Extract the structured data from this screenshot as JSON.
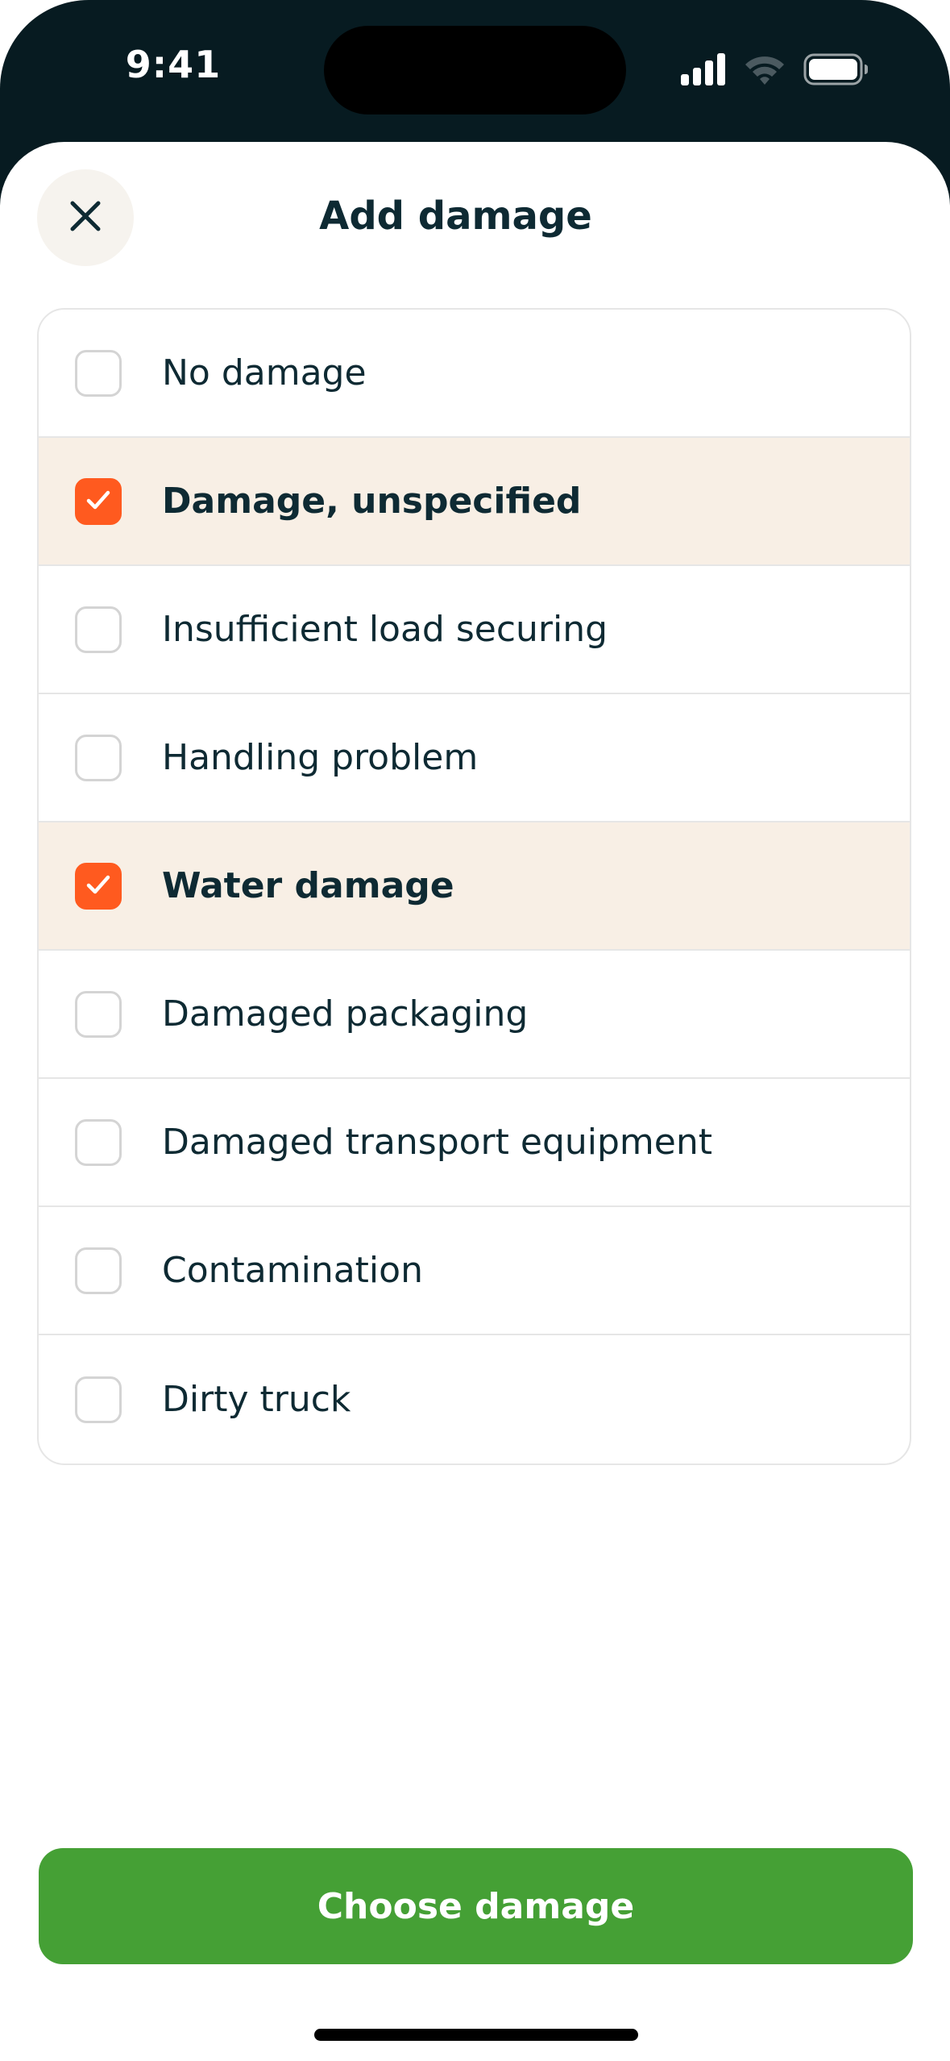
{
  "status_bar": {
    "time": "9:41",
    "icons": [
      "cellular-signal-icon",
      "wifi-icon",
      "battery-icon"
    ]
  },
  "sheet": {
    "title": "Add damage",
    "close_icon": "close-icon"
  },
  "options": [
    {
      "label": "No damage",
      "checked": false
    },
    {
      "label": "Damage, unspecified",
      "checked": true
    },
    {
      "label": "Insufficient load securing",
      "checked": false
    },
    {
      "label": "Handling problem",
      "checked": false
    },
    {
      "label": "Water damage",
      "checked": true
    },
    {
      "label": "Damaged packaging",
      "checked": false
    },
    {
      "label": "Damaged transport equipment",
      "checked": false
    },
    {
      "label": "Contamination",
      "checked": false
    },
    {
      "label": "Dirty truck",
      "checked": false
    }
  ],
  "footer": {
    "button_label": "Choose damage"
  },
  "colors": {
    "accent_orange": "#ff5a1f",
    "primary_green": "#45a035",
    "selected_row_bg": "#f8efe5",
    "title_text": "#0e2a33",
    "status_bar_bg": "#071b21"
  }
}
